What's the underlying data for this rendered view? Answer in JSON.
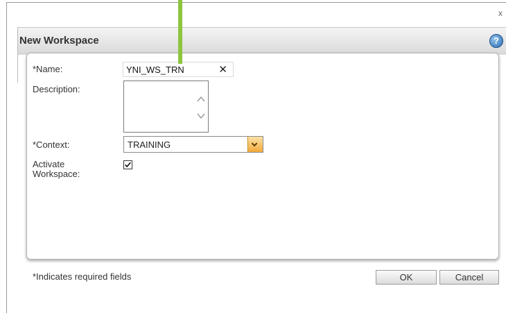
{
  "dialog": {
    "title": "New Workspace",
    "close_glyph": "x",
    "help_glyph": "?"
  },
  "form": {
    "name_label": "*Name:",
    "name_value": "YNI_WS_TRN",
    "clear_glyph": "✕",
    "description_label": "Description:",
    "description_value": "",
    "context_label": "*Context:",
    "context_value": "TRAINING",
    "activate_label": "Activate Workspace:",
    "activate_checked": true
  },
  "footer": {
    "required_note": "*Indicates required fields",
    "ok_label": "OK",
    "cancel_label": "Cancel"
  },
  "colors": {
    "accent_green": "#8cc63f",
    "dropdown_orange": "#f2a93b",
    "help_blue": "#2f6fb4"
  },
  "icons": {
    "close": "close-icon",
    "help": "help-icon",
    "clear": "clear-icon",
    "scroll_up": "chevron-up-icon",
    "scroll_down": "chevron-down-icon",
    "dropdown": "chevron-down-icon",
    "checkbox": "checkmark-icon"
  }
}
